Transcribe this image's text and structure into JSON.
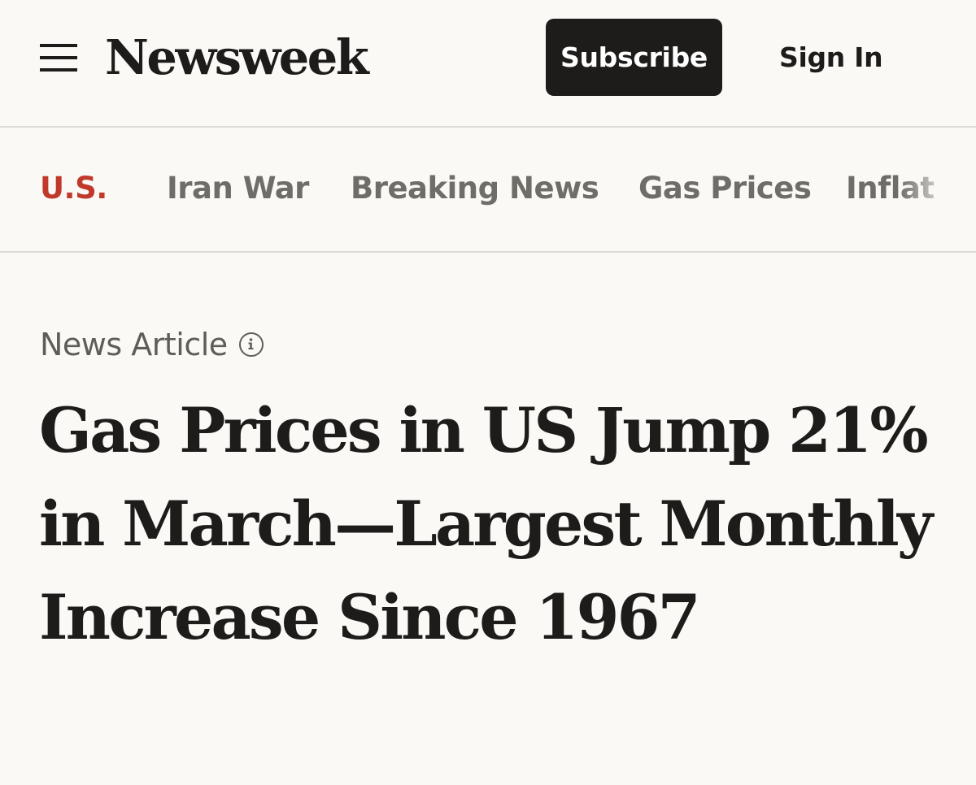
{
  "header": {
    "logo": "Newsweek",
    "subscribe_label": "Subscribe",
    "signin_label": "Sign In",
    "menu_icon": "hamburger-menu-icon"
  },
  "nav": {
    "items": [
      {
        "label": "U.S.",
        "active": true
      },
      {
        "label": "Iran War",
        "active": false
      },
      {
        "label": "Breaking News",
        "active": false
      },
      {
        "label": "Gas Prices",
        "active": false
      },
      {
        "label": "Inflat",
        "active": false
      }
    ],
    "active_color": "#c0392b"
  },
  "article": {
    "kicker": "News Article",
    "kicker_icon": "info-icon",
    "headline": "Gas Prices in US Jump 21% in March—Largest Monthly Increase Since 1967"
  }
}
